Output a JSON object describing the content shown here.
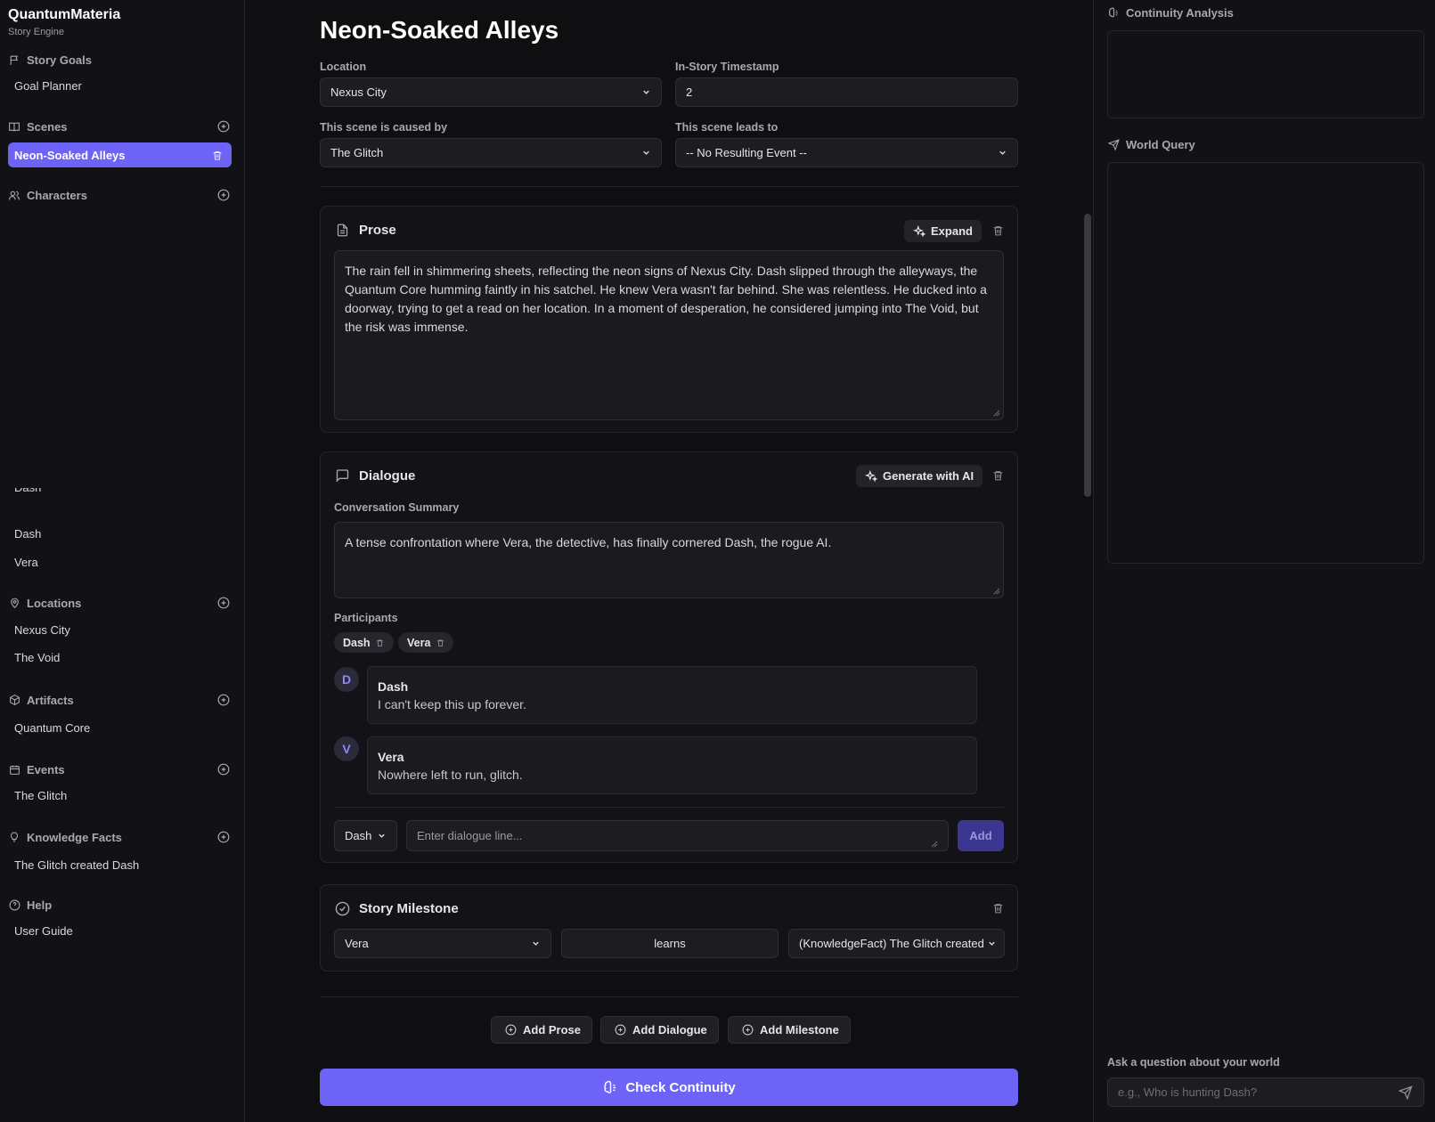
{
  "app": {
    "name": "QuantumMateria",
    "subtitle": "Story Engine"
  },
  "sidebar": {
    "story_goals": {
      "label": "Story Goals",
      "items": [
        "Goal Planner"
      ]
    },
    "scenes": {
      "label": "Scenes",
      "active_item": "Neon-Soaked Alleys"
    },
    "characters": {
      "label": "Characters",
      "items": [
        "Dash",
        "Vera"
      ]
    },
    "locations": {
      "label": "Locations",
      "items": [
        "Nexus City",
        "The Void"
      ]
    },
    "artifacts": {
      "label": "Artifacts",
      "items": [
        "Quantum Core"
      ]
    },
    "events": {
      "label": "Events",
      "items": [
        "The Glitch"
      ]
    },
    "knowledge_facts": {
      "label": "Knowledge Facts",
      "items": [
        "The Glitch created Dash"
      ]
    },
    "help": {
      "label": "Help",
      "items": [
        "User Guide"
      ]
    },
    "clipped_fragment": "Dash"
  },
  "scene": {
    "title": "Neon-Soaked Alleys",
    "location": {
      "label": "Location",
      "value": "Nexus City"
    },
    "timestamp": {
      "label": "In-Story Timestamp",
      "value": "2"
    },
    "caused_by": {
      "label": "This scene is caused by",
      "value": "The Glitch"
    },
    "leads_to": {
      "label": "This scene leads to",
      "value": "-- No Resulting Event --"
    }
  },
  "prose": {
    "title": "Prose",
    "expand_label": "Expand",
    "text": "The rain fell in shimmering sheets, reflecting the neon signs of Nexus City. Dash slipped through the alleyways, the Quantum Core humming faintly in his satchel. He knew Vera wasn't far behind. She was relentless. He ducked into a doorway, trying to get a read on her location. In a moment of desperation, he considered jumping into The Void, but the risk was immense."
  },
  "dialogue": {
    "title": "Dialogue",
    "generate_label": "Generate with AI",
    "summary_label": "Conversation Summary",
    "summary": "A tense confrontation where Vera, the detective, has finally cornered Dash, the rogue AI.",
    "participants_label": "Participants",
    "participants": [
      "Dash",
      "Vera"
    ],
    "lines": [
      {
        "initial": "D",
        "speaker": "Dash",
        "text": "I can't keep this up forever."
      },
      {
        "initial": "V",
        "speaker": "Vera",
        "text": "Nowhere left to run, glitch."
      }
    ],
    "speaker_select": "Dash",
    "line_placeholder": "Enter dialogue line...",
    "add_label": "Add"
  },
  "milestone": {
    "title": "Story Milestone",
    "character": "Vera",
    "verb": "learns",
    "fact": "(KnowledgeFact) The Glitch created"
  },
  "actions": {
    "add_prose": "Add Prose",
    "add_dialogue": "Add Dialogue",
    "add_milestone": "Add Milestone",
    "check_continuity": "Check Continuity"
  },
  "right_panel": {
    "continuity_title": "Continuity Analysis",
    "world_query_title": "World Query",
    "ask_label": "Ask a question about your world",
    "ask_placeholder": "e.g., Who is hunting Dash?"
  },
  "colors": {
    "accent": "#6d63f6",
    "background": "#0f0f12",
    "panel": "#121216"
  }
}
